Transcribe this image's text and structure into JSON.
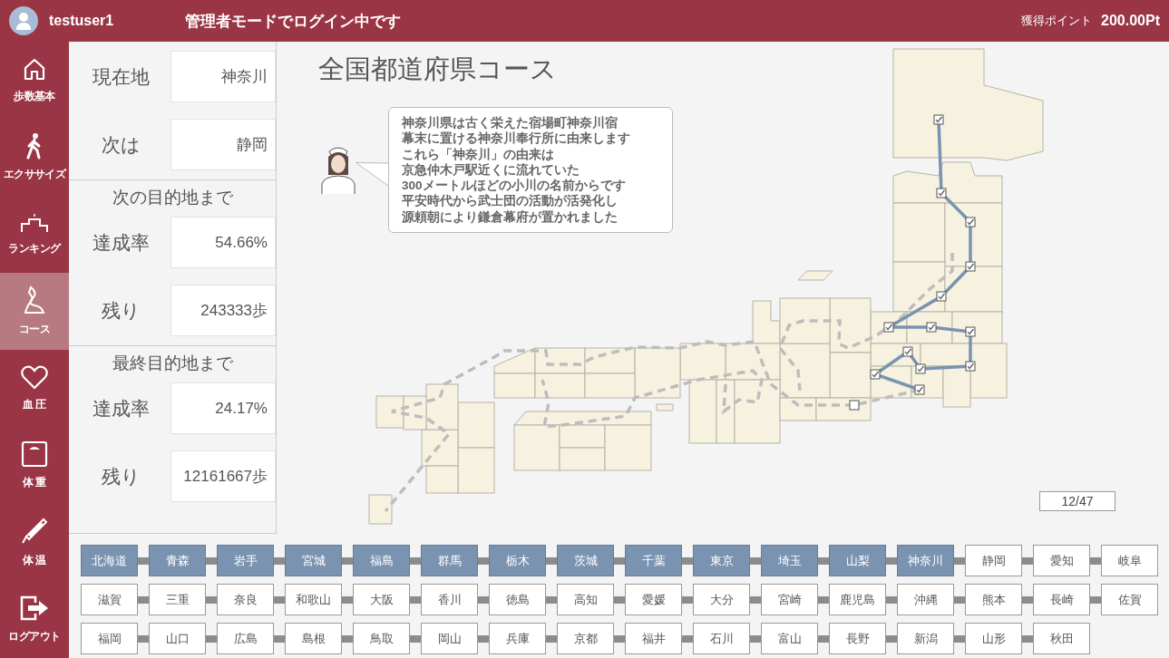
{
  "header": {
    "user": "testuser1",
    "mode_message": "管理者モードでログイン中です",
    "points_label": "獲得ポイント",
    "points": "200.00Pt"
  },
  "nav": [
    {
      "label": "歩数基本",
      "selected": false
    },
    {
      "label": "エクササイズ",
      "selected": false
    },
    {
      "label": "ランキング",
      "selected": false
    },
    {
      "label": "コース",
      "selected": true
    },
    {
      "label": "血 圧",
      "selected": false
    },
    {
      "label": "体 重",
      "selected": false
    },
    {
      "label": "体 温",
      "selected": false
    },
    {
      "label": "ログアウト",
      "selected": false
    }
  ],
  "status": [
    {
      "kind": "field",
      "label": "現在地",
      "value": "神奈川"
    },
    {
      "kind": "field",
      "label": "次は",
      "value": "静岡"
    },
    {
      "kind": "heading",
      "label": "次の目的地まで"
    },
    {
      "kind": "field",
      "label": "達成率",
      "value": "54.66%"
    },
    {
      "kind": "field",
      "label": "残り",
      "value": "243333歩"
    },
    {
      "kind": "heading",
      "label": "最終目的地まで"
    },
    {
      "kind": "field",
      "label": "達成率",
      "value": "24.17%"
    },
    {
      "kind": "field",
      "label": "残り",
      "value": "12161667歩"
    }
  ],
  "course": {
    "title": "全国都道府県コース",
    "message_lines": [
      "神奈川県は古く栄えた宿場町神奈川宿",
      "幕末に置ける神奈川奉行所に由来します",
      "これら「神奈川」の由来は",
      "京急仲木戸駅近くに流れていた",
      "300メートルほどの小川の名前からです",
      "平安時代から武士団の活動が活発化し",
      "源頼朝により鎌倉幕府が置かれました"
    ],
    "progress": "12/47"
  },
  "prefectures": [
    {
      "name": "北海道",
      "reached": true
    },
    {
      "name": "青森",
      "reached": true
    },
    {
      "name": "岩手",
      "reached": true
    },
    {
      "name": "宮城",
      "reached": true
    },
    {
      "name": "福島",
      "reached": true
    },
    {
      "name": "群馬",
      "reached": true
    },
    {
      "name": "栃木",
      "reached": true
    },
    {
      "name": "茨城",
      "reached": true
    },
    {
      "name": "千葉",
      "reached": true
    },
    {
      "name": "東京",
      "reached": true
    },
    {
      "name": "埼玉",
      "reached": true
    },
    {
      "name": "山梨",
      "reached": true
    },
    {
      "name": "神奈川",
      "reached": true
    },
    {
      "name": "静岡",
      "reached": false
    },
    {
      "name": "愛知",
      "reached": false
    },
    {
      "name": "岐阜",
      "reached": false
    },
    {
      "name": "滋賀",
      "reached": false
    },
    {
      "name": "三重",
      "reached": false
    },
    {
      "name": "奈良",
      "reached": false
    },
    {
      "name": "和歌山",
      "reached": false
    },
    {
      "name": "大阪",
      "reached": false
    },
    {
      "name": "香川",
      "reached": false
    },
    {
      "name": "徳島",
      "reached": false
    },
    {
      "name": "高知",
      "reached": false
    },
    {
      "name": "愛媛",
      "reached": false
    },
    {
      "name": "大分",
      "reached": false
    },
    {
      "name": "宮崎",
      "reached": false
    },
    {
      "name": "鹿児島",
      "reached": false
    },
    {
      "name": "沖縄",
      "reached": false
    },
    {
      "name": "熊本",
      "reached": false
    },
    {
      "name": "長崎",
      "reached": false
    },
    {
      "name": "佐賀",
      "reached": false
    },
    {
      "name": "福岡",
      "reached": false
    },
    {
      "name": "山口",
      "reached": false
    },
    {
      "name": "広島",
      "reached": false
    },
    {
      "name": "島根",
      "reached": false
    },
    {
      "name": "鳥取",
      "reached": false
    },
    {
      "name": "岡山",
      "reached": false
    },
    {
      "name": "兵庫",
      "reached": false
    },
    {
      "name": "京都",
      "reached": false
    },
    {
      "name": "福井",
      "reached": false
    },
    {
      "name": "石川",
      "reached": false
    },
    {
      "name": "富山",
      "reached": false
    },
    {
      "name": "長野",
      "reached": false
    },
    {
      "name": "新潟",
      "reached": false
    },
    {
      "name": "山形",
      "reached": false
    },
    {
      "name": "秋田",
      "reached": false
    }
  ]
}
